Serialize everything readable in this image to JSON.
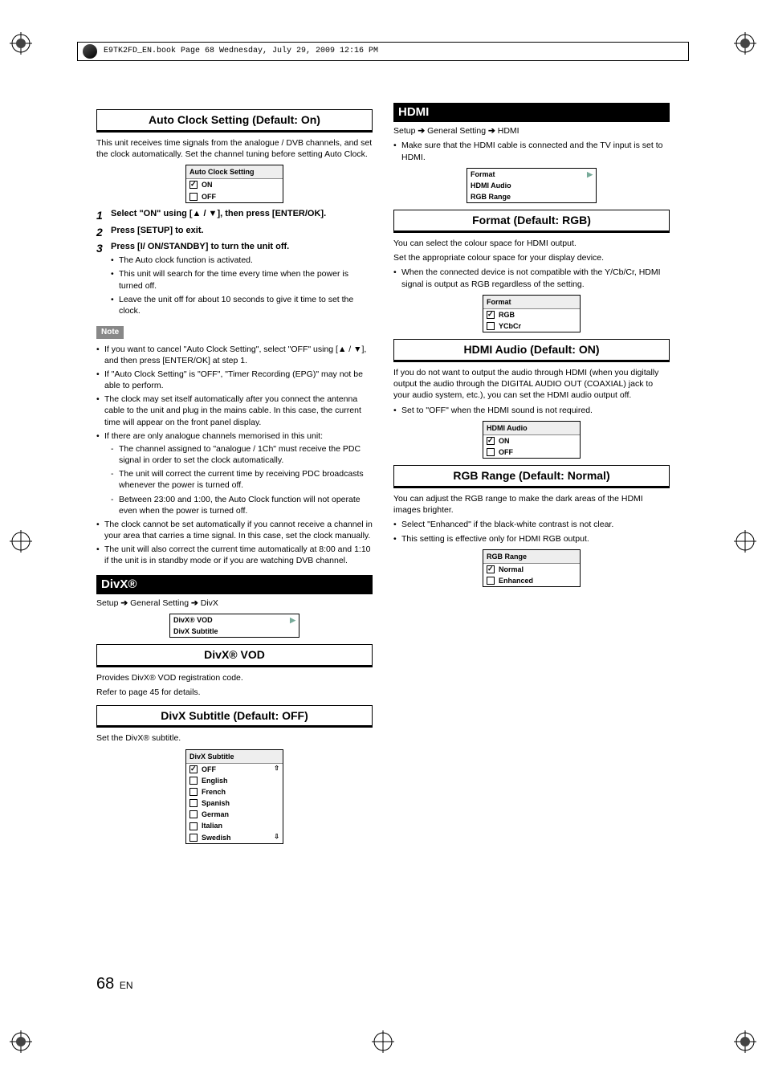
{
  "header": "E9TK2FD_EN.book  Page 68  Wednesday, July 29, 2009  12:16 PM",
  "left": {
    "h_autoclock": "Auto Clock Setting (Default: On)",
    "p_intro": "This unit receives time signals from the analogue / DVB channels, and set the clock automatically. Set the channel tuning before setting Auto Clock.",
    "box_autoclock": {
      "title": "Auto Clock Setting",
      "opts": [
        "ON",
        "OFF"
      ],
      "checked": 0
    },
    "step1": "Select \"ON\" using [▲ / ▼], then press [ENTER/OK].",
    "step2": "Press [SETUP] to exit.",
    "step3": "Press [I/ ON/STANDBY] to turn the unit off.",
    "step3_bul": [
      "The Auto clock function is activated.",
      "This unit will search for the time every time when the power is turned off.",
      "Leave the unit off for about 10 seconds to give it time to set the clock."
    ],
    "note_label": "Note",
    "note_bul": [
      "If you want to cancel \"Auto Clock Setting\", select \"OFF\" using [▲ / ▼], and then press [ENTER/OK] at step 1.",
      "If \"Auto Clock Setting\" is \"OFF\", \"Timer Recording (EPG)\" may not be able to perform.",
      "The clock may set itself automatically after you connect the antenna cable to the unit and plug in the mains cable. In this case, the current time will appear on the front panel display.",
      "If there are only analogue channels memorised in this unit:"
    ],
    "note_dash": [
      "The channel assigned to \"analogue / 1Ch\" must receive the PDC signal in order to set the clock automatically.",
      "The unit will correct the current time by receiving PDC broadcasts whenever the power is turned off.",
      "Between 23:00 and 1:00, the Auto Clock function will not operate even when the power is turned off."
    ],
    "note_bul2": [
      "The clock cannot be set automatically if you cannot receive a channel in your area that carries a time signal. In this case, set the clock manually.",
      "The unit will also correct the current time automatically at 8:00 and 1:10 if the unit is in standby mode or if you are watching DVB channel."
    ],
    "h_divx": "DivX®",
    "crumb_divx": [
      "Setup",
      "General Setting",
      "DivX"
    ],
    "box_divx": {
      "rows": [
        "DivX® VOD",
        "DivX Subtitle"
      ]
    },
    "h_divxvod": "DivX® VOD",
    "divxvod_p1": "Provides DivX® VOD registration code.",
    "divxvod_p2": "Refer to page 45 for details.",
    "h_divxsub": "DivX Subtitle (Default: OFF)",
    "divxsub_p": "Set the DivX® subtitle.",
    "box_divxsub": {
      "title": "DivX Subtitle",
      "opts": [
        "OFF",
        "English",
        "French",
        "Spanish",
        "German",
        "Italian",
        "Swedish"
      ],
      "checked": 0
    }
  },
  "right": {
    "h_hdmi": "HDMI",
    "crumb_hdmi": [
      "Setup",
      "General Setting",
      "HDMI"
    ],
    "hdmi_bul1": "Make sure that the HDMI cable is connected and the TV input is set to HDMI.",
    "box_hdmi": {
      "rows": [
        "Format",
        "HDMI Audio",
        "RGB Range"
      ]
    },
    "h_format": "Format (Default: RGB)",
    "format_p1": "You can select the colour space for HDMI output.",
    "format_p2": "Set the appropriate colour space for your display device.",
    "format_bul": "When the connected device is not compatible with the Y/Cb/Cr, HDMI signal is output as RGB regardless of the setting.",
    "box_format": {
      "title": "Format",
      "opts": [
        "RGB",
        "YCbCr"
      ],
      "checked": 0
    },
    "h_audio": "HDMI Audio (Default: ON)",
    "audio_p1": "If you do not want to output the audio through HDMI (when you digitally output the audio through the DIGITAL AUDIO OUT (COAXIAL) jack to your audio system, etc.), you can set the HDMI audio output off.",
    "audio_bul": "Set to \"OFF\" when the HDMI sound is not required.",
    "box_audio": {
      "title": "HDMI Audio",
      "opts": [
        "ON",
        "OFF"
      ],
      "checked": 0
    },
    "h_rgb": "RGB Range (Default: Normal)",
    "rgb_p1": "You can adjust the RGB range to make the dark areas of the HDMI images brighter.",
    "rgb_bul": [
      "Select \"Enhanced\" if the black-white contrast is not clear.",
      "This setting is effective only for HDMI RGB output."
    ],
    "box_rgb": {
      "title": "RGB Range",
      "opts": [
        "Normal",
        "Enhanced"
      ],
      "checked": 0
    }
  },
  "foot": {
    "num": "68",
    "lang": "EN"
  }
}
